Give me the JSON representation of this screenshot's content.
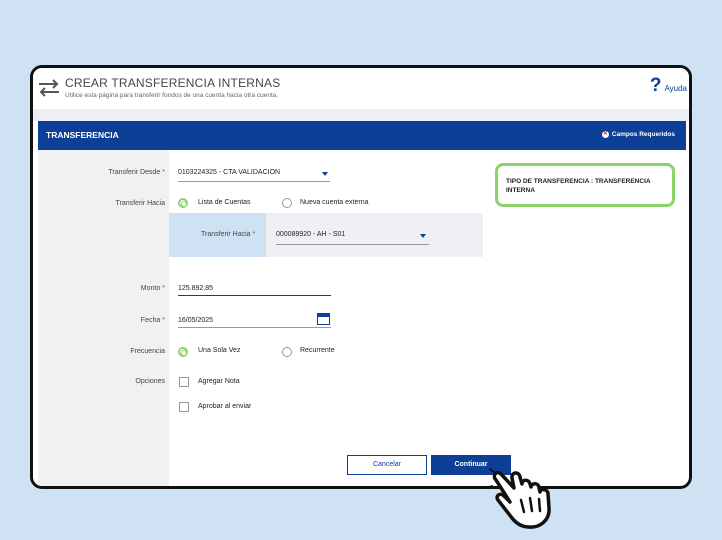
{
  "header": {
    "title": "CREAR TRANSFERENCIA INTERNAS",
    "subtitle": "Utilice esta página para transferir fondos de una cuenta hacia otra cuenta.",
    "help_label": "Ayuda",
    "help_icon": "question-mark-icon",
    "transfer_icon": "transfer-arrows-icon"
  },
  "section": {
    "title": "TRANSFERENCIA",
    "required_note": "Campos Requeridos",
    "required_mark": "*"
  },
  "form": {
    "from_label": "Transferir Desde",
    "from_value": "0103224325 - CTA VALIDACION",
    "to_label": "Transferir Hacia",
    "to_options": [
      "Lista de Cuentas",
      "Nueva cuenta externa"
    ],
    "to_selected": "Lista de Cuentas",
    "to_account_label": "Transferir Hacia",
    "to_account_value": "000089920 - AH - S01",
    "amount_label": "Monto",
    "amount_value": "125.892,85",
    "date_label": "Fecha",
    "date_value": "16/05/2025",
    "frequency_label": "Frecuencia",
    "frequency_options": [
      "Una Sola Vez",
      "Recurrente"
    ],
    "frequency_selected": "Una Sola Vez",
    "options_label": "Opciones",
    "option_items": [
      "Agregar Nota",
      "Aprobar al enviar"
    ]
  },
  "info_box": {
    "text": "TIPO DE TRANSFERENCIA : TRANSFERENCIA INTERNA"
  },
  "buttons": {
    "cancel": "Cancelar",
    "continue": "Continuar"
  },
  "colors": {
    "brand": "#0c3f95",
    "highlight": "#8bd46a",
    "required": "#c0392b",
    "background": "#cfe2f3"
  }
}
